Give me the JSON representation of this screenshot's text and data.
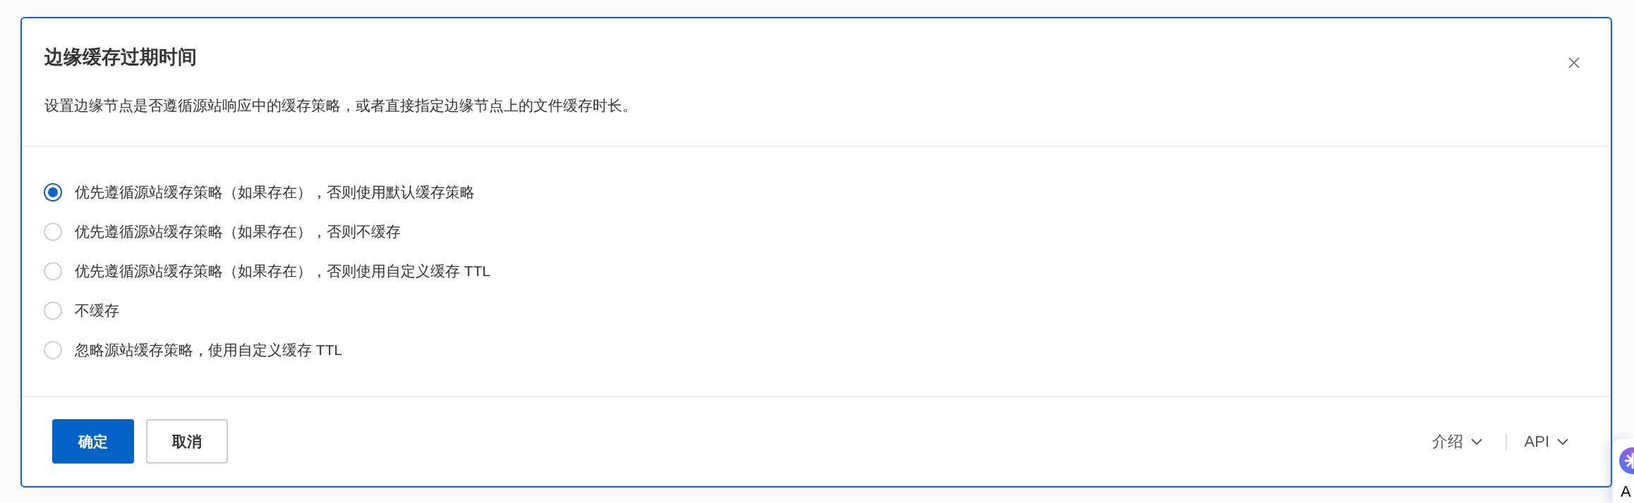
{
  "dialog": {
    "title": "边缘缓存过期时间",
    "description": "设置边缘节点是否遵循源站响应中的缓存策略，或者直接指定边缘节点上的文件缓存时长。",
    "options": [
      {
        "label": "优先遵循源站缓存策略（如果存在），否则使用默认缓存策略",
        "selected": true
      },
      {
        "label": "优先遵循源站缓存策略（如果存在），否则不缓存",
        "selected": false
      },
      {
        "label": "优先遵循源站缓存策略（如果存在），否则使用自定义缓存 TTL",
        "selected": false
      },
      {
        "label": "不缓存",
        "selected": false
      },
      {
        "label": "忽略源站缓存策略，使用自定义缓存 TTL",
        "selected": false
      }
    ],
    "buttons": [
      {
        "label": "确定",
        "kind": "primary"
      },
      {
        "label": "取消",
        "kind": "secondary"
      }
    ],
    "links": [
      {
        "label": "介绍"
      },
      {
        "label": "API"
      }
    ]
  },
  "floating_widget": {
    "label": "A"
  }
}
